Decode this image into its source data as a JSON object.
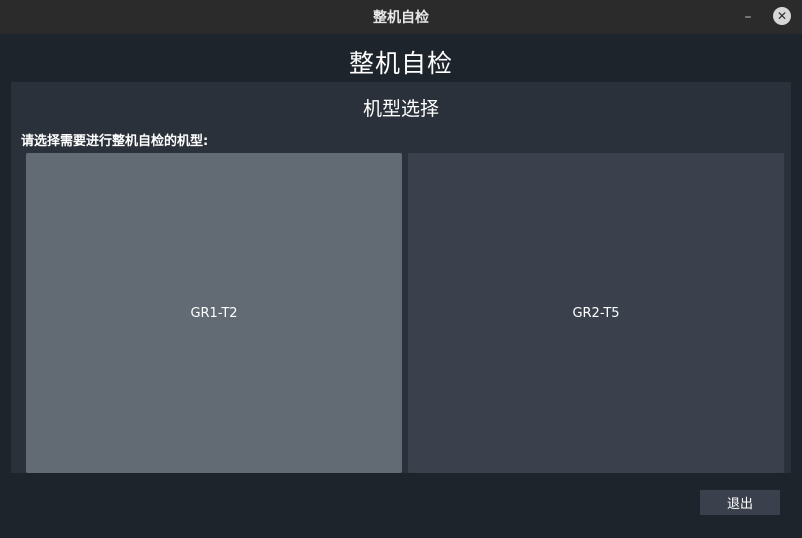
{
  "window": {
    "title": "整机自检",
    "minimize_symbol": "–",
    "close_symbol": "✕"
  },
  "page": {
    "title": "整机自检"
  },
  "panel": {
    "title": "机型选择",
    "prompt": "请选择需要进行整机自检的机型:"
  },
  "models": [
    {
      "label": "GR1-T2",
      "selected": true
    },
    {
      "label": "GR2-T5",
      "selected": false
    }
  ],
  "footer": {
    "exit_label": "退出"
  },
  "colors": {
    "background": "#1e242c",
    "panel": "#2a313a",
    "card_selected": "#626a74",
    "card_default": "#3a414c"
  }
}
